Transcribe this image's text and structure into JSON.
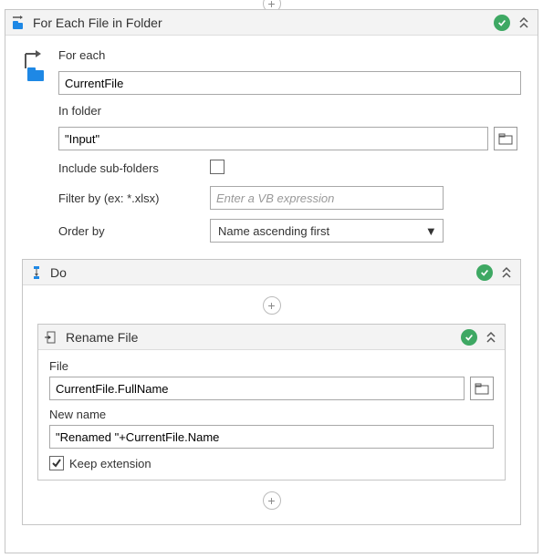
{
  "root": {
    "title": "For Each File in Folder",
    "for_each": {
      "label": "For each",
      "value": "CurrentFile"
    },
    "in_folder": {
      "label": "In folder",
      "value": "\"Input\""
    },
    "include_sub": {
      "label": "Include sub-folders",
      "checked": false
    },
    "filter_by": {
      "label": "Filter by (ex: *.xlsx)",
      "placeholder": "Enter a VB expression",
      "value": ""
    },
    "order_by": {
      "label": "Order by",
      "selected": "Name ascending first"
    }
  },
  "do": {
    "title": "Do"
  },
  "rename": {
    "title": "Rename File",
    "file": {
      "label": "File",
      "value": "CurrentFile.FullName"
    },
    "new_name": {
      "label": "New name",
      "value": "\"Renamed \"+CurrentFile.Name"
    },
    "keep_ext": {
      "label": "Keep extension",
      "checked": true
    }
  }
}
